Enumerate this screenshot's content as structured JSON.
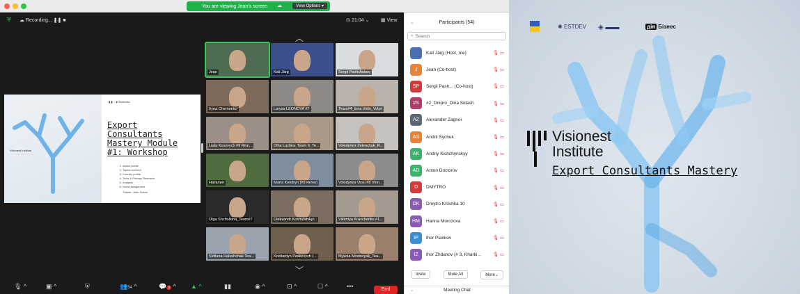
{
  "banner": {
    "message": "You are viewing Jean's screen",
    "options": "View Options"
  },
  "topbar": {
    "recording": "Recording...",
    "clock": "21:04",
    "view": "View"
  },
  "slide": {
    "title": "Export Consultants Mastery Module #1: Workshop",
    "agenda": [
      "Action points",
      "Topics covered",
      "Country profile",
      "Tools & Primary Research",
      "Analysis",
      "Home assignment"
    ],
    "trainer": "Trainer: Jean Sutton",
    "brand": "Visionest Institute",
    "business": "Business"
  },
  "gallery": [
    {
      "name": "Jean",
      "bg": "#4f6b52",
      "active": true
    },
    {
      "name": "Kati Järg",
      "bg": "#3b4f8a"
    },
    {
      "name": "Sergii Pashchukov",
      "bg": "#d9dde2"
    },
    {
      "name": "Iryna Chernenko",
      "bg": "#7d6a5a"
    },
    {
      "name": "Larysa LEONOVA #7",
      "bg": "#8d8a86"
    },
    {
      "name": "Team#4_Inna Voilo_Volyn",
      "bg": "#b9b3ab"
    },
    {
      "name": "Luda Kosovych #9 Rivn...",
      "bg": "#9c8f87"
    },
    {
      "name": "Olha Luchka_Team 6_Te...",
      "bg": "#a89988"
    },
    {
      "name": "Volodymyr Zelenchuk_R...",
      "bg": "#c6c3bf"
    },
    {
      "name": "Наталия",
      "bg": "#4f6c3f"
    },
    {
      "name": "Marta Kondryn (#9 Rivne)",
      "bg": "#7e8e9e"
    },
    {
      "name": "Volodymyr Ursu #8 Vinn...",
      "bg": "#8c8c8c"
    },
    {
      "name": "Olga Shcholkina_Team#7",
      "bg": "#2a2a2a"
    },
    {
      "name": "Oleksandr Kostrubitskyi...",
      "bg": "#7b6e60"
    },
    {
      "name": "Viktoriya Kravchenko #1...",
      "bg": "#a49a90"
    },
    {
      "name": "Svitlana Halushchak Tea...",
      "bg": "#9aa3ad"
    },
    {
      "name": "Kostiantyn Paskevych (...",
      "bg": "#6f5f4e"
    },
    {
      "name": "Mykola Mostovyak_Tea...",
      "bg": "#9a7f6c"
    }
  ],
  "toolbar": {
    "participants_count": "54",
    "chat_badge": "3",
    "end": "End"
  },
  "participants": {
    "header": "Participants (54)",
    "search_placeholder": "Search",
    "list": [
      {
        "initials": "",
        "color": "#4a6fb3",
        "name": "Kati Järg (Host, me)"
      },
      {
        "initials": "J",
        "color": "#e8833a",
        "name": "Jean (Co-host)"
      },
      {
        "initials": "SP",
        "color": "#d13b3b",
        "name": "Sergii Pash... (Co-host)"
      },
      {
        "initials": "#S",
        "color": "#b23b6a",
        "name": "#2_Dnipro_Dina Sidash"
      },
      {
        "initials": "AZ",
        "color": "#5b6878",
        "name": "Alexander Zagnoi"
      },
      {
        "initials": "AS",
        "color": "#e8833a",
        "name": "Andrii Sychuk"
      },
      {
        "initials": "AK",
        "color": "#3bb36a",
        "name": "Andriy Kishchynskyy"
      },
      {
        "initials": "AD",
        "color": "#3bb36a",
        "name": "Anton Doctorov"
      },
      {
        "initials": "D",
        "color": "#d13b3b",
        "name": "DMYTRO"
      },
      {
        "initials": "DK",
        "color": "#8a5bb3",
        "name": "Dmytro Kroshka 10"
      },
      {
        "initials": "HM",
        "color": "#8a5bb3",
        "name": "Hanna Morozova"
      },
      {
        "initials": "IP",
        "color": "#3b8fd1",
        "name": "Ihor Piankov"
      },
      {
        "initials": "IZ",
        "color": "#8a5bb3",
        "name": "Ihor Zhdanov (# 3, Kharki..."
      }
    ],
    "invite": "Invite",
    "mute_all": "Mute All",
    "more": "More",
    "chat": "Meeting Chat"
  },
  "brand": {
    "estdev": "ESTDEV",
    "business": "Бізнес",
    "title_line1": "Visionest",
    "title_line2": "Institute",
    "title_line3": "Export Consultants Mastery"
  }
}
